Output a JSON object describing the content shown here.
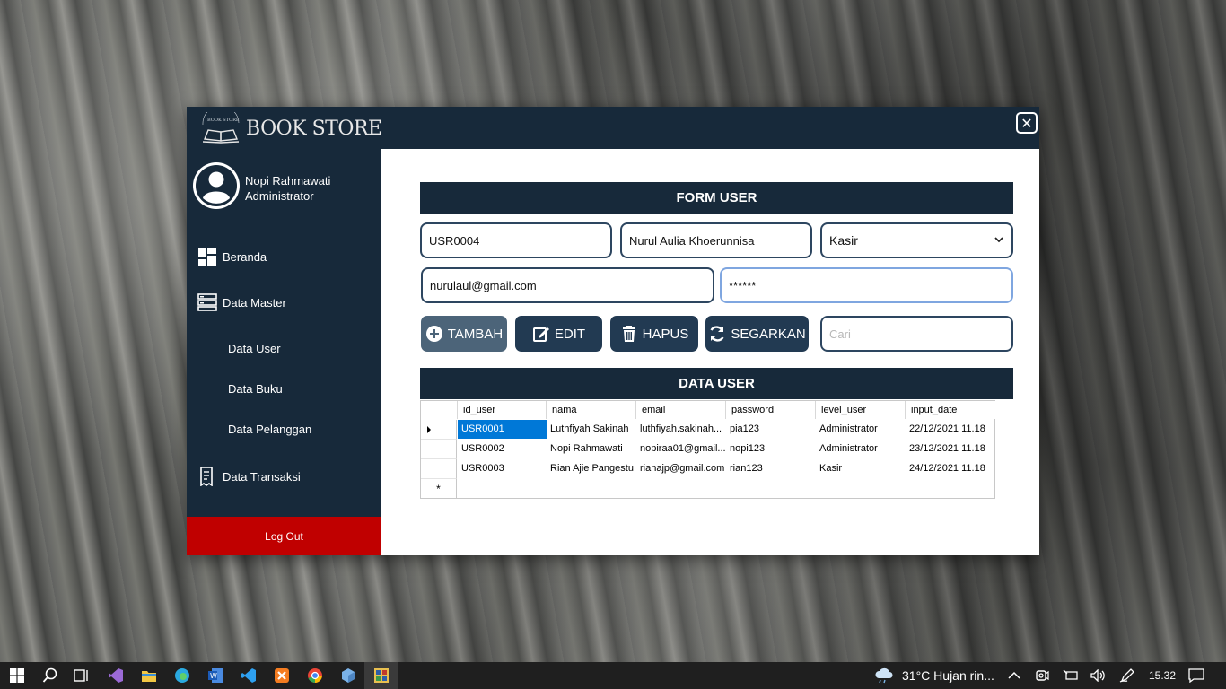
{
  "app": {
    "brand": "BOOK STORE",
    "logo_arc_text": "BOOK STORE"
  },
  "user": {
    "name": "Nopi Rahmawati",
    "role": "Administrator"
  },
  "sidebar": {
    "items": [
      {
        "label": "Beranda",
        "icon": "dashboard-icon"
      },
      {
        "label": "Data Master",
        "icon": "server-icon"
      },
      {
        "label": "Data User"
      },
      {
        "label": "Data Buku"
      },
      {
        "label": "Data Pelanggan"
      },
      {
        "label": "Data Transaksi",
        "icon": "receipt-icon"
      }
    ],
    "logout_label": "Log Out"
  },
  "form": {
    "title": "FORM USER",
    "id_user": "USR0004",
    "nama": "Nurul Aulia Khoerunnisa",
    "level": "Kasir",
    "email": "nurulaul@gmail.com",
    "password": "******",
    "search_placeholder": "Cari",
    "buttons": {
      "tambah": "TAMBAH",
      "edit": "EDIT",
      "hapus": "HAPUS",
      "segarkan": "SEGARKAN"
    }
  },
  "data_user": {
    "title": "DATA USER",
    "columns": [
      "id_user",
      "nama",
      "email",
      "password",
      "level_user",
      "input_date"
    ],
    "rows": [
      [
        "USR0001",
        "Luthfiyah Sakinah",
        "luthfiyah.sakinah...",
        "pia123",
        "Administrator",
        "22/12/2021 11.18"
      ],
      [
        "USR0002",
        "Nopi Rahmawati",
        "nopiraa01@gmail...",
        "nopi123",
        "Administrator",
        "23/12/2021 11.18"
      ],
      [
        "USR0003",
        "Rian Ajie Pangestu",
        "rianajp@gmail.com",
        "rian123",
        "Kasir",
        "24/12/2021 11.18"
      ]
    ],
    "new_row_marker": "*"
  },
  "taskbar": {
    "weather": "31°C  Hujan rin...",
    "time": "15.32"
  },
  "colors": {
    "navy": "#17293a",
    "button": "#223a52",
    "logout": "#c00000",
    "selection": "#0078d7"
  }
}
